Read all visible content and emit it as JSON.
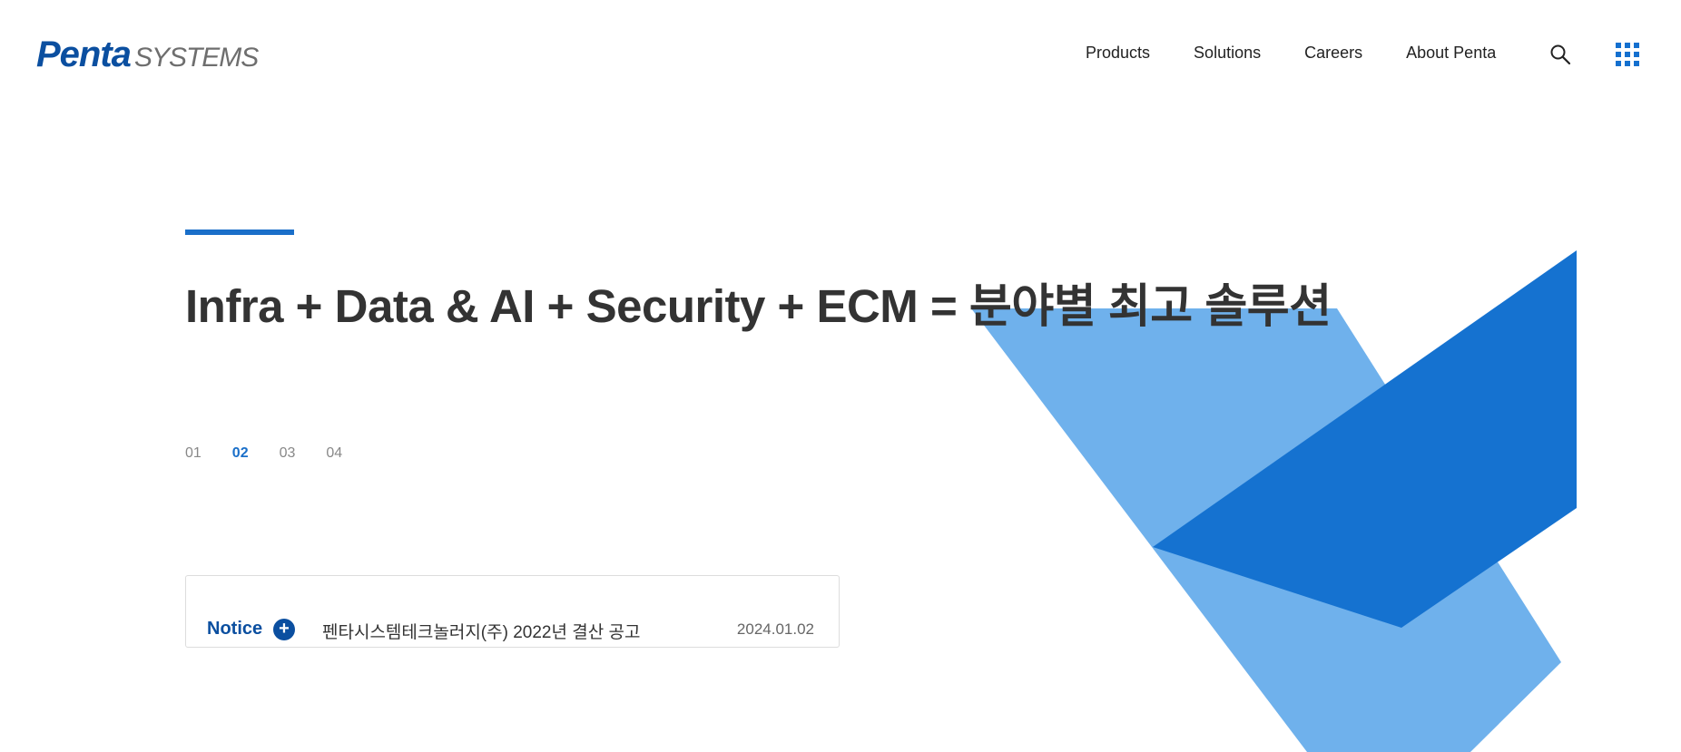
{
  "header": {
    "logo_bold": "Penta",
    "logo_light": "SYSTEMS",
    "nav": [
      "Products",
      "Solutions",
      "Careers",
      "About Penta"
    ],
    "search_icon": "search-icon",
    "menu_icon": "grid-menu-icon"
  },
  "hero": {
    "headline": "Infra + Data & AI + Security + ECM = 분야별 최고 솔루션",
    "slides": [
      "01",
      "02",
      "03",
      "04"
    ],
    "active_slide": "02"
  },
  "notice": {
    "label": "Notice",
    "more_icon": "plus-circle-icon",
    "title": "펜타시스템테크놀러지(주) 2022년 결산 공고",
    "date": "2024.01.02"
  },
  "colors": {
    "brand_dark": "#0b4fa0",
    "accent": "#1a6fc9",
    "shape_light": "#6fb1ec",
    "shape_dark": "#1572d0"
  }
}
